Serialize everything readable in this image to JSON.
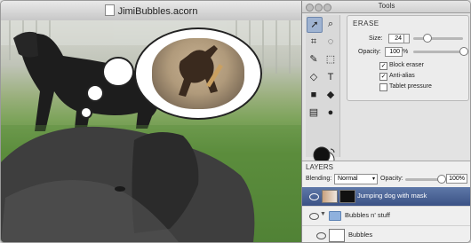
{
  "document": {
    "title": "JimiBubbles.acorn"
  },
  "tools_panel": {
    "title": "Tools",
    "tools": [
      {
        "name": "move-tool"
      },
      {
        "name": "zoom-tool"
      },
      {
        "name": "crop-tool"
      },
      {
        "name": "lasso-tool"
      },
      {
        "name": "brush-tool"
      },
      {
        "name": "marquee-tool"
      },
      {
        "name": "eraser-tool"
      },
      {
        "name": "text-tool"
      },
      {
        "name": "rectangle-tool"
      },
      {
        "name": "fill-tool"
      },
      {
        "name": "gradient-tool"
      },
      {
        "name": "ellipse-tool"
      }
    ]
  },
  "erase_settings": {
    "title": "ERASE",
    "size_label": "Size:",
    "size_value": "24",
    "size_slider_fraction": 0.27,
    "opacity_label": "Opacity:",
    "opacity_value": "100",
    "opacity_unit": "%",
    "opacity_slider_fraction": 1.0,
    "block_eraser_label": "Block eraser",
    "block_eraser_checked": true,
    "anti_alias_label": "Anti-alias",
    "anti_alias_checked": true,
    "tablet_pressure_label": "Tablet pressure",
    "tablet_pressure_checked": false
  },
  "layers": {
    "title": "LAYERS",
    "blending_label": "Blending:",
    "blending_value": "Normal",
    "opacity_label": "Opacity:",
    "opacity_value": "100%",
    "opacity_slider_fraction": 1.0,
    "items": [
      {
        "label": "Jumping dog with mask",
        "active": true
      },
      {
        "label": "Bubbles n' stuff",
        "active": false
      },
      {
        "label": "Bubbles",
        "active": false
      }
    ]
  },
  "colors": {
    "layer_selected": "#4b629a",
    "tool_selected": "#9fb3d1"
  }
}
